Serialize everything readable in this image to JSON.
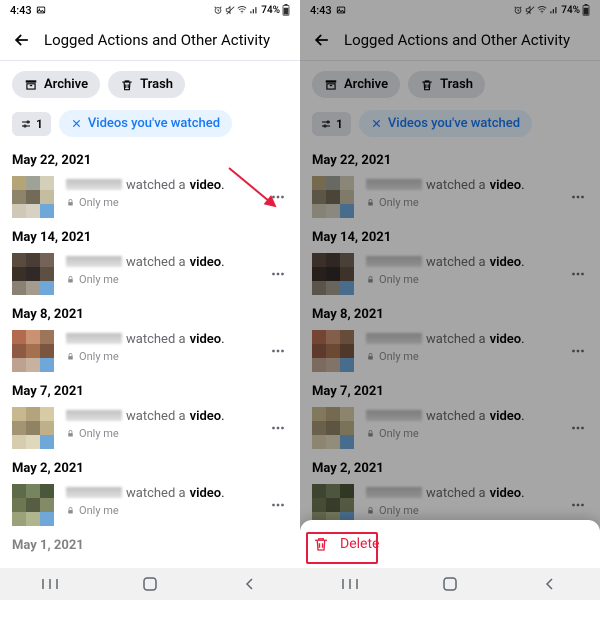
{
  "status_bar": {
    "time": "4:43",
    "battery_text": "74%"
  },
  "header": {
    "title": "Logged Actions and Other Activity"
  },
  "actions": {
    "archive": "Archive",
    "trash": "Trash"
  },
  "filter": {
    "count": "1",
    "chip_label": "Videos you've watched"
  },
  "strings": {
    "watched_a": "watched a",
    "video_word": "video",
    "period": ".",
    "only_me": "Only me"
  },
  "entries": [
    {
      "date": "May 22, 2021"
    },
    {
      "date": "May 14, 2021"
    },
    {
      "date": "May 8, 2021"
    },
    {
      "date": "May 7, 2021"
    },
    {
      "date": "May 2, 2021"
    },
    {
      "date": "May 1, 2021"
    }
  ],
  "delete": {
    "label": "Delete"
  }
}
